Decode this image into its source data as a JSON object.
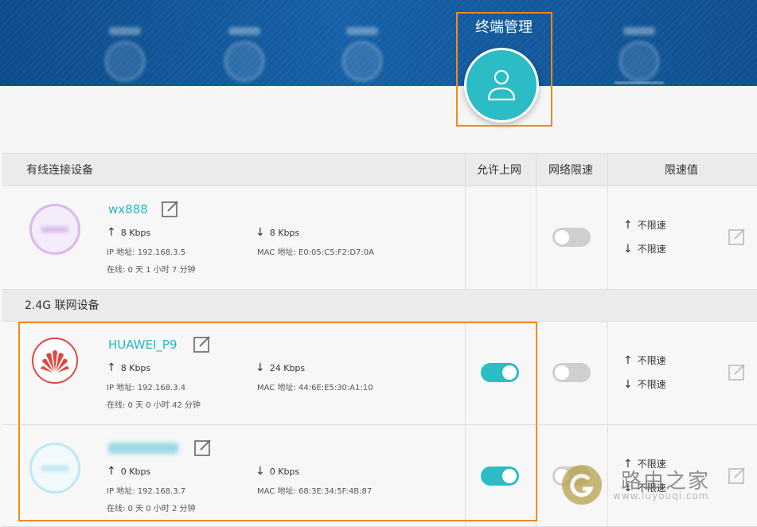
{
  "header": {
    "active_tab": "终端管理",
    "nav_tabs": [
      "",
      "",
      "",
      "",
      ""
    ]
  },
  "table": {
    "columns": [
      "有线连接设备",
      "允许上网",
      "网络限速",
      "限速值"
    ]
  },
  "sections": {
    "wifi24": "2.4G 联网设备"
  },
  "devices": [
    {
      "name": "wx888",
      "up": "8 Kbps",
      "down": "8 Kbps",
      "ip": "IP 地址: 192.168.3.5",
      "mac": "MAC 地址: E0:05:C5:F2:D7:0A",
      "online": "在线:  0 天 1 小时 7 分钟",
      "allow": null,
      "limit": false,
      "limit_up": "不限速",
      "limit_down": "不限速"
    },
    {
      "name": "HUAWEI_P9",
      "up": "8 Kbps",
      "down": "24 Kbps",
      "ip": "IP 地址: 192.168.3.4",
      "mac": "MAC 地址: 44:6E:E5:30:A1:10",
      "online": "在线:  0 天 0 小时 42 分钟",
      "allow": true,
      "limit": false,
      "limit_up": "不限速",
      "limit_down": "不限速"
    },
    {
      "name": "",
      "up": "0 Kbps",
      "down": "0 Kbps",
      "ip": "IP 地址: 192.168.3.7",
      "mac": "MAC 地址: 68:3E:34:5F:4B:87",
      "online": "在线:  0 天 0 小时 2 分钟",
      "allow": true,
      "limit": false,
      "limit_up": "不限速",
      "limit_down": "不限速"
    }
  ],
  "arrows": {
    "up": "↑",
    "down": "↓"
  },
  "watermark": {
    "title": "路由之家",
    "sub": "www.luyouqi.com"
  },
  "colors": {
    "accent": "#2bbcc5",
    "header": "#1560a6",
    "highlight": "#f08a1e",
    "huawei": "#e0483e"
  }
}
